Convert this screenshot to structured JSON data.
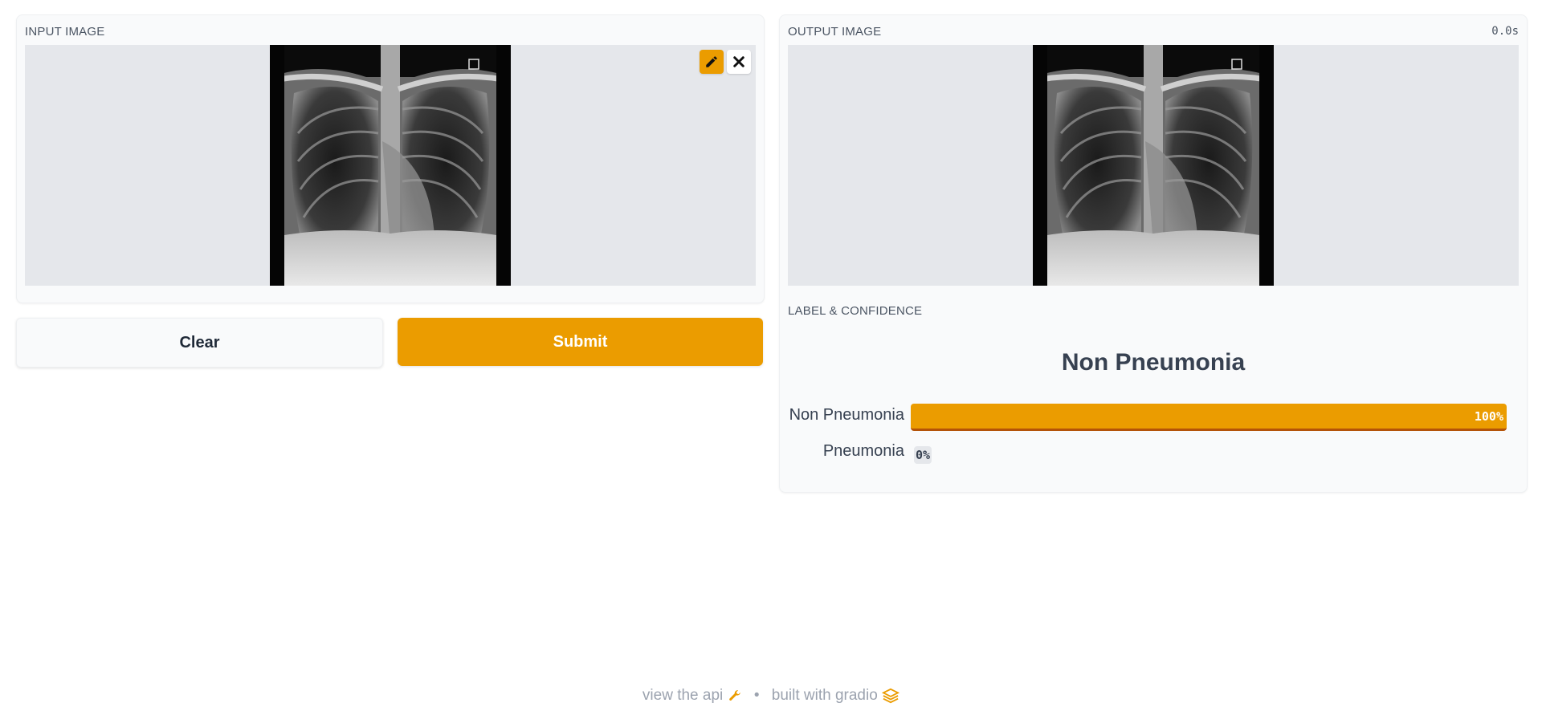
{
  "input": {
    "label": "INPUT IMAGE",
    "edit_icon": "pencil-icon",
    "clear_icon": "close-icon"
  },
  "output": {
    "label": "OUTPUT IMAGE",
    "timer": "0.0s"
  },
  "buttons": {
    "clear": "Clear",
    "submit": "Submit"
  },
  "label_confidence": {
    "label": "LABEL & CONFIDENCE",
    "prediction": "Non Pneumonia",
    "rows": [
      {
        "name": "Non Pneumonia",
        "confidence": 1.0,
        "pct_text": "100%"
      },
      {
        "name": "Pneumonia",
        "confidence": 0.0,
        "pct_text": "0%"
      }
    ]
  },
  "footer": {
    "api_text": "view the api",
    "separator": "•",
    "built_text": "built with gradio"
  },
  "colors": {
    "accent": "#eb9c00",
    "panel_bg": "#f9fafb",
    "image_bg": "#e5e7eb"
  }
}
